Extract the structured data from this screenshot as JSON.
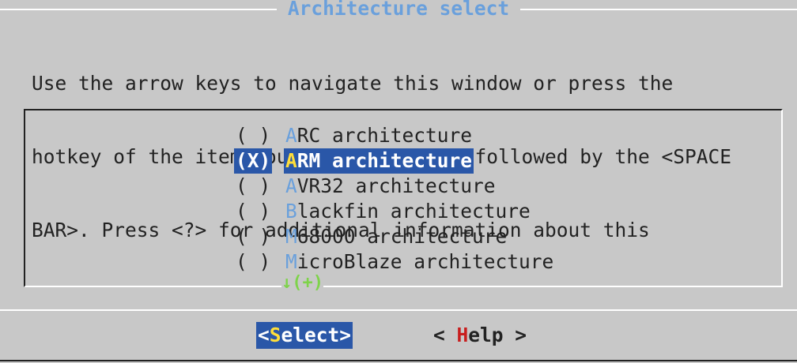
{
  "dialog": {
    "title": "Architecture select",
    "intro_lines": [
      "Use the arrow keys to navigate this window or press the",
      "hotkey of the item you wish to select followed by the <SPACE",
      "BAR>. Press <?> for additional information about this"
    ]
  },
  "menu": {
    "items": [
      {
        "radio": "( )",
        "hotkey": "A",
        "rest": "RC architecture",
        "selected": false
      },
      {
        "radio": "(X)",
        "hotkey": "A",
        "rest": "RM architecture",
        "selected": true
      },
      {
        "radio": "( )",
        "hotkey": "A",
        "rest": "VR32 architecture",
        "selected": false
      },
      {
        "radio": "( )",
        "hotkey": "B",
        "rest": "lackfin architecture",
        "selected": false
      },
      {
        "radio": "( )",
        "hotkey": "M",
        "rest": "68000 architecture",
        "selected": false
      },
      {
        "radio": "( )",
        "hotkey": "M",
        "rest": "icroBlaze architecture",
        "selected": false
      }
    ],
    "more_indicator": "↓(+)"
  },
  "buttons": {
    "select": {
      "prefix": "<",
      "hotkey": "S",
      "rest": "elect>"
    },
    "help": {
      "prefix": "< ",
      "hotkey": "H",
      "rest": "elp >"
    }
  },
  "colors": {
    "background": "#c8c8c8",
    "highlight": "#2a57a8",
    "hotkey": "#6aa0dc",
    "selected_hotkey": "#ffde3a",
    "help_hotkey": "#c81e1e",
    "more_indicator": "#7ed34a"
  }
}
